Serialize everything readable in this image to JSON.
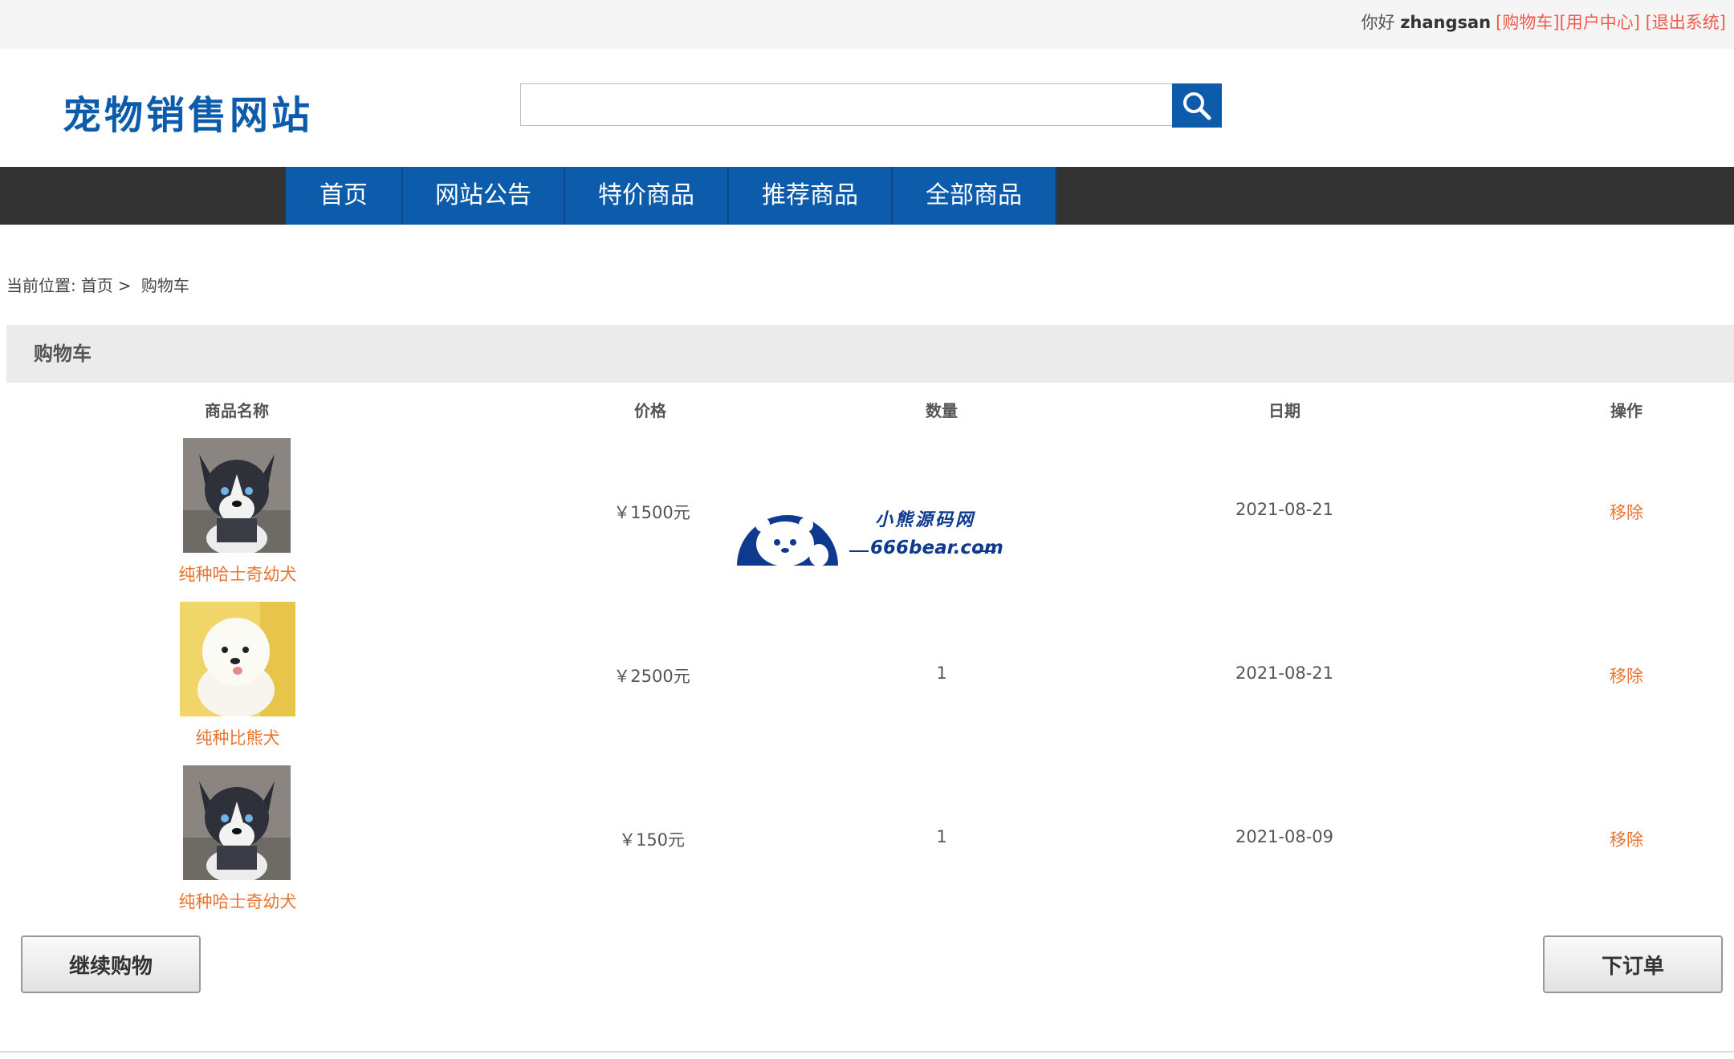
{
  "topbar": {
    "greeting": "你好",
    "username": "zhangsan",
    "cart_link": "[购物车]",
    "user_center_link": "[用户中心]",
    "logout_link": "[退出系统]"
  },
  "header": {
    "site_title": "宠物销售网站",
    "search_placeholder": ""
  },
  "nav": {
    "items": [
      "首页",
      "网站公告",
      "特价商品",
      "推荐商品",
      "全部商品"
    ]
  },
  "breadcrumb": {
    "prefix": "当前位置:",
    "home": "首页",
    "separator": ">",
    "current": "购物车"
  },
  "section": {
    "title": "购物车"
  },
  "table": {
    "headers": [
      "商品名称",
      "价格",
      "数量",
      "日期",
      "操作"
    ],
    "rows": [
      {
        "name": "纯种哈士奇幼犬",
        "price": "￥1500元",
        "quantity": "",
        "date": "2021-08-21",
        "action": "移除",
        "image": "husky-puppy"
      },
      {
        "name": "纯种比熊犬",
        "price": "￥2500元",
        "quantity": "1",
        "date": "2021-08-21",
        "action": "移除",
        "image": "bichon-puppy"
      },
      {
        "name": "纯种哈士奇幼犬",
        "price": "￥150元",
        "quantity": "1",
        "date": "2021-08-09",
        "action": "移除",
        "image": "husky-puppy"
      }
    ]
  },
  "buttons": {
    "continue_shopping": "继续购物",
    "place_order": "下订单"
  },
  "watermark": {
    "line1": "小熊源码网",
    "line2": "666bear.com"
  },
  "colors": {
    "brand_blue": "#0d5cab",
    "nav_dark": "#333333",
    "link_orange": "#e9732f",
    "topbar_red": "#f05a4a"
  }
}
